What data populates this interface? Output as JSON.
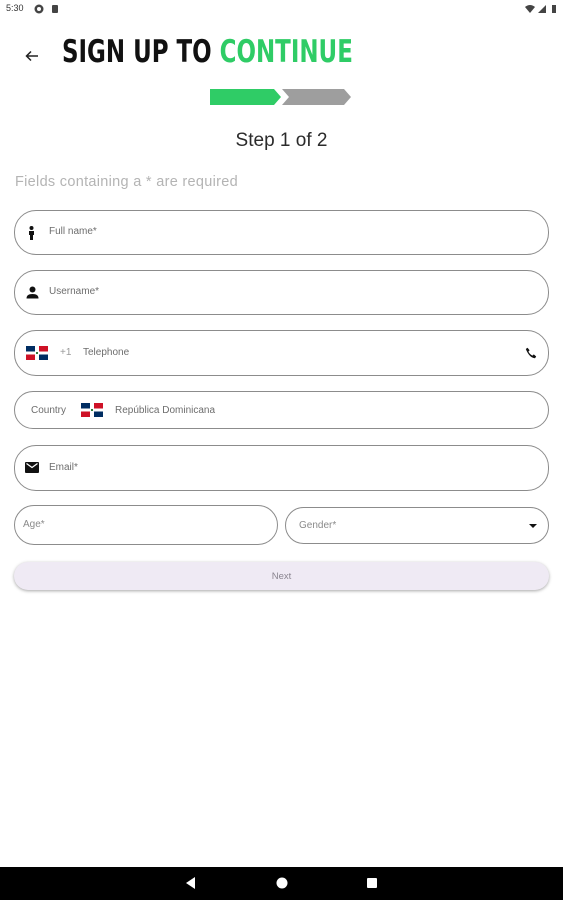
{
  "status": {
    "time": "5:30"
  },
  "header": {
    "title_part1": "SIGN UP TO ",
    "title_part2": "CONTINUE",
    "step_text": "Step 1 of 2",
    "progress": {
      "current_step": 1,
      "total_steps": 2
    }
  },
  "form": {
    "required_note": "Fields containing a * are required",
    "full_name_placeholder": "Full name*",
    "username_placeholder": "Username*",
    "phone_code": "+1",
    "phone_placeholder": "Telephone",
    "country_label": "Country",
    "country_value": "República Dominicana",
    "email_placeholder": "Email*",
    "age_placeholder": "Age*",
    "gender_placeholder": "Gender*",
    "next_label": "Next"
  },
  "colors": {
    "accent": "#2fcc66",
    "progress_inactive": "#9e9e9e",
    "button_bg": "#efeaf4"
  }
}
